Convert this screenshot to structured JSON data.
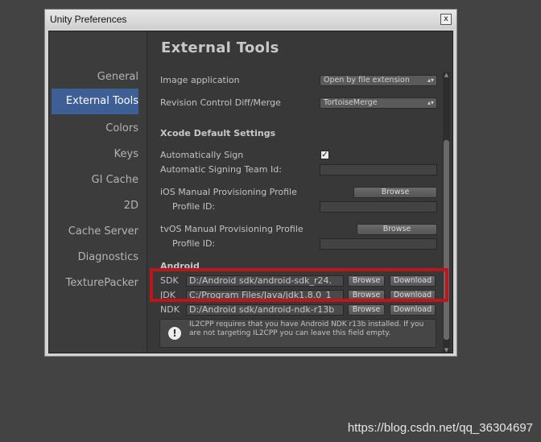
{
  "window": {
    "title": "Unity Preferences",
    "close_label": "x"
  },
  "sidebar": {
    "items": [
      {
        "label": "General"
      },
      {
        "label": "External Tools"
      },
      {
        "label": "Colors"
      },
      {
        "label": "Keys"
      },
      {
        "label": "GI Cache"
      },
      {
        "label": "2D"
      },
      {
        "label": "Cache Server"
      },
      {
        "label": "Diagnostics"
      },
      {
        "label": "TexturePacker"
      }
    ],
    "active": "External Tools"
  },
  "content": {
    "heading": "External Tools",
    "image_application": {
      "label": "Image application",
      "value": "Open by file extension"
    },
    "revision_control": {
      "label": "Revision Control Diff/Merge",
      "value": "TortoiseMerge"
    },
    "xcode": {
      "heading": "Xcode Default Settings",
      "auto_sign_label": "Automatically Sign",
      "auto_sign_checked": true,
      "team_id_label": "Automatic Signing Team Id:",
      "ios_profile_label": "iOS Manual Provisioning Profile",
      "ios_profile_id_label": "Profile ID:",
      "tvos_profile_label": "tvOS Manual Provisioning Profile",
      "tvos_profile_id_label": "Profile ID:"
    },
    "browse_label": "Browse",
    "download_label": "Download",
    "android": {
      "heading": "Android",
      "sdk": {
        "label": "SDK",
        "path": "D:/Android sdk/android-sdk_r24."
      },
      "jdk": {
        "label": "JDK",
        "path": "C:/Program Files/Java/jdk1.8.0_1"
      },
      "ndk": {
        "label": "NDK",
        "path": "D:/Android sdk/android-ndk-r13b"
      },
      "help_text": "IL2CPP requires that you have Android NDK r13b installed. If you are not targeting IL2CPP you can leave this field empty.",
      "help_icon": "exclamation-icon"
    }
  },
  "watermark": "https://blog.csdn.net/qq_36304697",
  "colors": {
    "highlight": "#c0141b",
    "selection": "#3e5f96"
  }
}
